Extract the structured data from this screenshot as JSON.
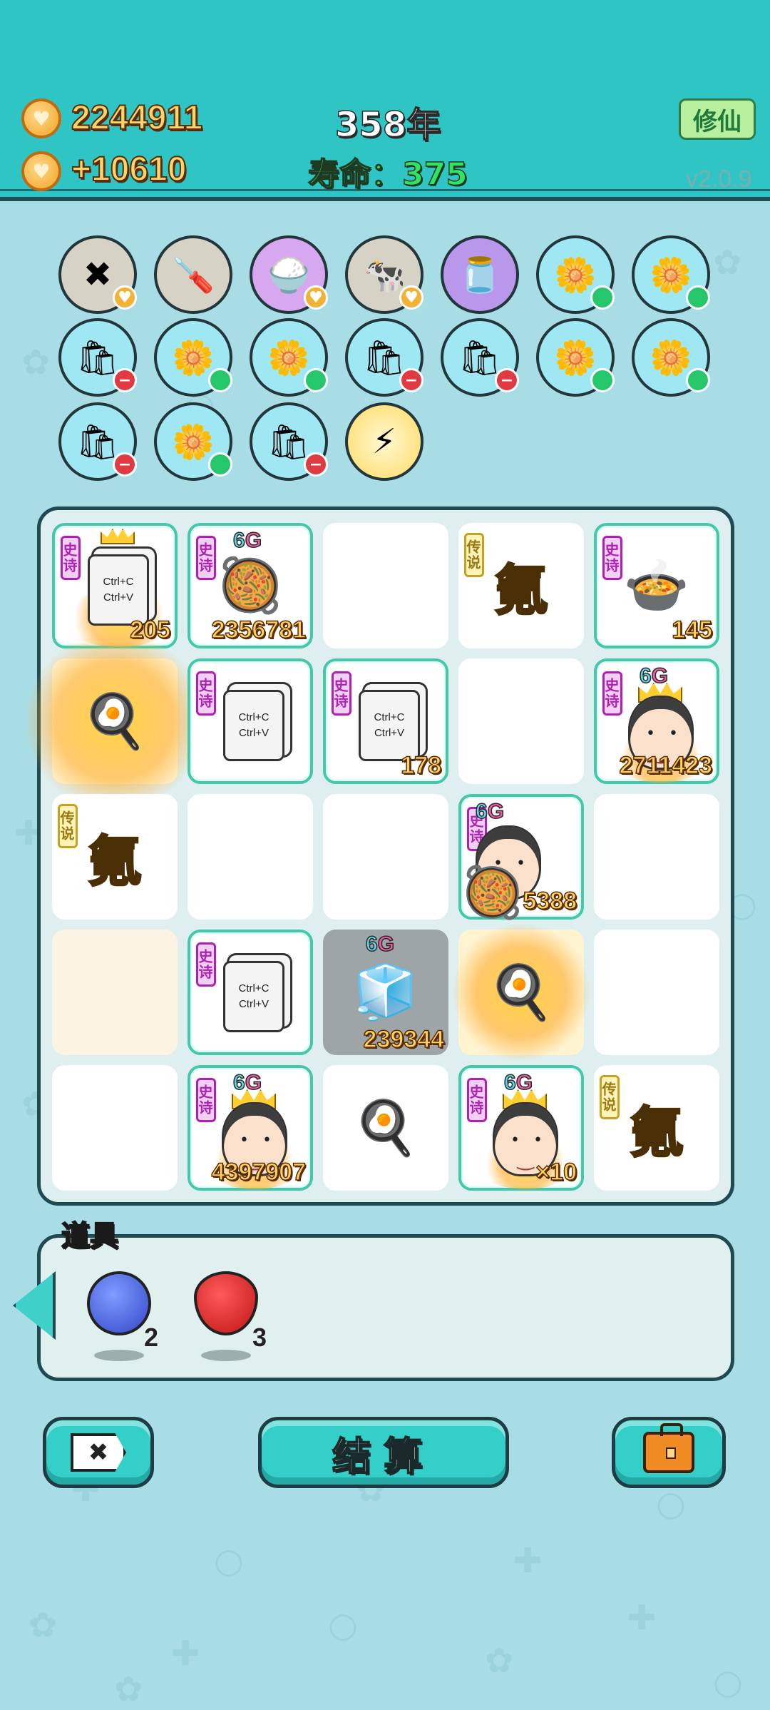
{
  "header": {
    "coins": "2244911",
    "income": "+10610",
    "year": "358年",
    "lifespan": "寿命：375",
    "cultivate_button": "修仙",
    "version": "v2.0.9"
  },
  "relics": [
    {
      "icon": "delete-tag-icon",
      "glyph": "✖",
      "badge": "heart"
    },
    {
      "icon": "screwdriver-icon",
      "glyph": "🪛",
      "badge": ""
    },
    {
      "icon": "rice-bowl-icon",
      "glyph": "🍚",
      "badge": "heart"
    },
    {
      "icon": "cows-icon",
      "glyph": "🐄",
      "badge": "heart"
    },
    {
      "icon": "milk-jar-icon",
      "glyph": "🫙",
      "badge": ""
    },
    {
      "icon": "potted-flower-icon",
      "glyph": "🌼",
      "badge": "plus"
    },
    {
      "icon": "potted-flower-icon",
      "glyph": "🌼",
      "badge": "plus"
    },
    {
      "icon": "sack-icon",
      "glyph": "🛍",
      "badge": "minus"
    },
    {
      "icon": "potted-flower-icon",
      "glyph": "🌼",
      "badge": "plus"
    },
    {
      "icon": "potted-flower-icon",
      "glyph": "🌼",
      "badge": "plus"
    },
    {
      "icon": "sack-icon",
      "glyph": "🛍",
      "badge": "minus"
    },
    {
      "icon": "sack-icon",
      "glyph": "🛍",
      "badge": "minus"
    },
    {
      "icon": "potted-flower-icon",
      "glyph": "🌼",
      "badge": "plus"
    },
    {
      "icon": "potted-flower-icon",
      "glyph": "🌼",
      "badge": "plus"
    },
    {
      "icon": "sack-icon",
      "glyph": "🛍",
      "badge": "minus"
    },
    {
      "icon": "potted-flower-icon",
      "glyph": "🌼",
      "badge": "plus"
    },
    {
      "icon": "sack-icon",
      "glyph": "🛍",
      "badge": "minus"
    },
    {
      "icon": "lightning-icon",
      "glyph": "⚡",
      "badge": ""
    }
  ],
  "board": {
    "rarity_epic": "史诗",
    "rarity_legend": "传说",
    "ctrl_c": "Ctrl+C",
    "ctrl_v": "Ctrl+V",
    "gas_char": "氪",
    "sixg": "6G",
    "values": {
      "r1c1": "205",
      "r1c2": "2356781",
      "r1c5": "145",
      "r2c3": "178",
      "r2c5": "2711423",
      "r3c4": "5388",
      "r4c3": "239344",
      "r5c2": "4397907",
      "r5c4": "×10"
    }
  },
  "items": {
    "title": "道具",
    "list": [
      {
        "icon": "blueberry-icon",
        "count": "2"
      },
      {
        "icon": "strawberry-icon",
        "count": "3"
      }
    ]
  },
  "buttons": {
    "settle": "结算"
  },
  "colors": {
    "header_bg": "#2fc5c5",
    "page_bg": "#a9dde5",
    "epic": "#b020b4",
    "legend": "#c7a11f",
    "coin_text": "#ffd56a"
  }
}
